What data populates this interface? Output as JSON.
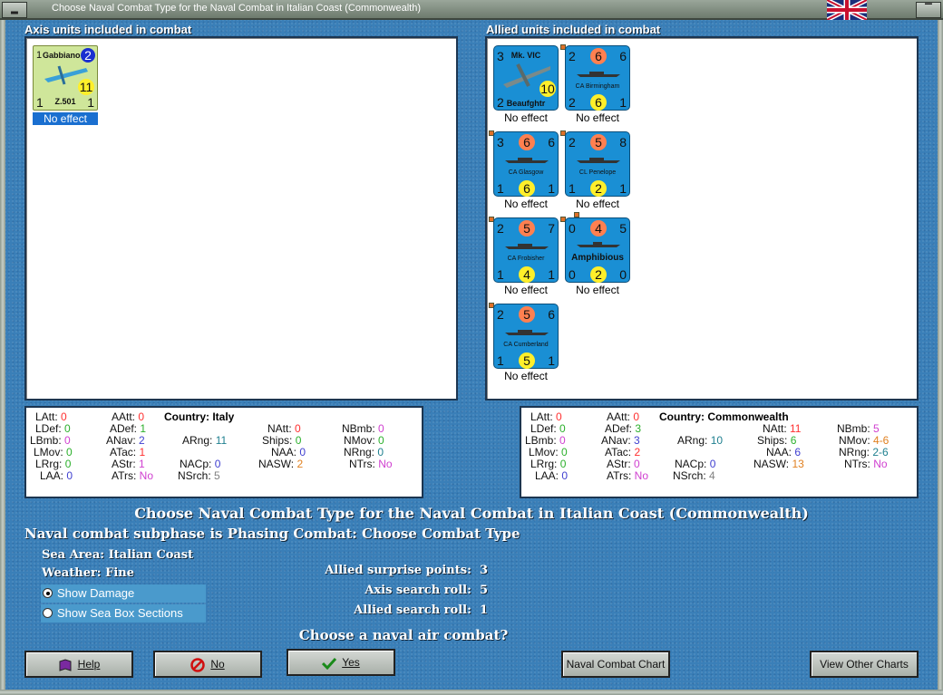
{
  "window": {
    "title": "Choose Naval Combat Type for the Naval Combat in Italian Coast (Commonwealth)"
  },
  "axis": {
    "header": "Axis units included in combat",
    "units": [
      {
        "tl": "1",
        "tr": "2",
        "name": "Gabbiano",
        "bottom": "Z.501",
        "mid": "11",
        "bl": "1",
        "br": "1",
        "status": "No effect"
      }
    ]
  },
  "allied": {
    "header": "Allied units included in combat",
    "units": [
      {
        "tl": "3",
        "tc": "",
        "tr": "",
        "name": "Mk. VIC",
        "sub": "Beaufghtr",
        "mid": "10",
        "bl": "2",
        "br": "",
        "status": "No effect"
      },
      {
        "tl": "2",
        "tc": "6",
        "tr": "6",
        "name": "CA Birmingham",
        "mid": "6",
        "bl": "2",
        "br": "1",
        "status": "No effect"
      },
      {
        "tl": "3",
        "tc": "6",
        "tr": "6",
        "name": "CA Glasgow",
        "mid": "6",
        "bl": "1",
        "br": "1",
        "status": "No effect"
      },
      {
        "tl": "2",
        "tc": "5",
        "tr": "8",
        "name": "CL Penelope",
        "mid": "2",
        "bl": "1",
        "br": "1",
        "status": "No effect"
      },
      {
        "tl": "2",
        "tc": "5",
        "tr": "7",
        "name": "CA Frobisher",
        "mid": "4",
        "bl": "1",
        "br": "1",
        "status": "No effect"
      },
      {
        "tl": "0",
        "tc": "4",
        "tr": "5",
        "name": "Amphibious",
        "mid": "2",
        "bl": "0",
        "br": "0",
        "status": "No effect"
      },
      {
        "tl": "2",
        "tc": "5",
        "tr": "6",
        "name": "CA Cumberland",
        "mid": "5",
        "bl": "1",
        "br": "1",
        "status": "No effect"
      }
    ]
  },
  "axis_stats": {
    "country": "Country: Italy",
    "LAtt": "0",
    "LDef": "0",
    "LBmb": "0",
    "LMov": "0",
    "LRrg": "0",
    "LAA": "0",
    "AAtt": "0",
    "ADef": "1",
    "ANav": "2",
    "ATac": "1",
    "AStr": "1",
    "ATrs": "No",
    "ARng": "11",
    "NAtt": "0",
    "Ships": "0",
    "NAA": "0",
    "NASW": "2",
    "NACp": "0",
    "NSrch": "5",
    "NBmb": "0",
    "NMov": "0",
    "NRng": "0",
    "NTrs": "No"
  },
  "allied_stats": {
    "country": "Country: Commonwealth",
    "LAtt": "0",
    "LDef": "0",
    "LBmb": "0",
    "LMov": "0",
    "LRrg": "0",
    "LAA": "0",
    "AAtt": "0",
    "ADef": "3",
    "ANav": "3",
    "ATac": "2",
    "AStr": "0",
    "ATrs": "No",
    "ARng": "10",
    "NAtt": "11",
    "Ships": "6",
    "NAA": "6",
    "NASW": "13",
    "NACp": "0",
    "NSrch": "4",
    "NBmb": "5",
    "NMov": "4-6",
    "NRng": "2-6",
    "NTrs": "No"
  },
  "info": {
    "title": "Choose Naval Combat Type for the Naval Combat in Italian Coast (Commonwealth)",
    "subphase": "Naval combat subphase is Phasing Combat: Choose Combat Type",
    "sea_area_label": "Sea Area:",
    "sea_area": "Italian Coast",
    "weather_label": "Weather:",
    "weather": "Fine",
    "show_damage": "Show Damage",
    "show_sections": "Show Sea Box Sections",
    "surprise_label": "Allied surprise points:",
    "surprise": "3",
    "axis_search_label": "Axis search roll:",
    "axis_search": "5",
    "allied_search_label": "Allied search roll:",
    "allied_search": "1",
    "question": "Choose a naval air combat?"
  },
  "buttons": {
    "help": "Help",
    "no": "No",
    "yes": "Yes",
    "chart": "Naval Combat Chart",
    "other": "View Other Charts"
  },
  "colors": {
    "accent": "#1a8fd4",
    "background": "#3a7fb8"
  }
}
